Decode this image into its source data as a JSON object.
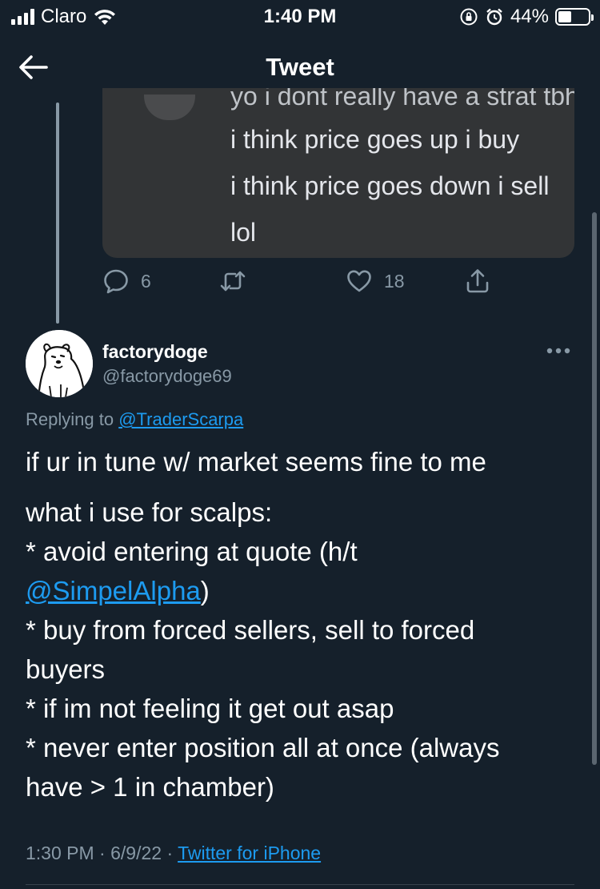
{
  "status_bar": {
    "carrier": "Claro",
    "time": "1:40 PM",
    "battery_percent": "44%",
    "battery_level": 0.44
  },
  "header": {
    "title": "Tweet"
  },
  "previous_tweet": {
    "media_text": {
      "partial_line": "yo i dont really have a strat tbh",
      "line1": "i think price goes up i buy",
      "line2": "i think price goes down i sell",
      "line3": "lol"
    },
    "reply_count": "6",
    "like_count": "18"
  },
  "tweet": {
    "display_name": "factorydoge",
    "handle": "@factorydoge69",
    "replying_prefix": "Replying to",
    "replying_to": "@TraderScarpa",
    "lines": {
      "l1": "if ur in tune w/ market seems fine to me",
      "l2": "what i use for scalps:",
      "l3": "* avoid entering at quote (h/t",
      "l4_mention": "@SimpelAlpha",
      "l4_suffix": ")",
      "l5": "* buy from forced sellers, sell to forced",
      "l6": "buyers",
      "l7": "* if im not feeling it get out asap",
      "l8": "* never enter position all at once (always",
      "l9": "have > 1 in chamber)"
    },
    "time": "1:30 PM",
    "date": "6/9/22",
    "separator": "·",
    "source": "Twitter for iPhone"
  },
  "colors": {
    "background": "#15202b",
    "accent": "#1d9bf0",
    "secondary_text": "#8899a6"
  }
}
